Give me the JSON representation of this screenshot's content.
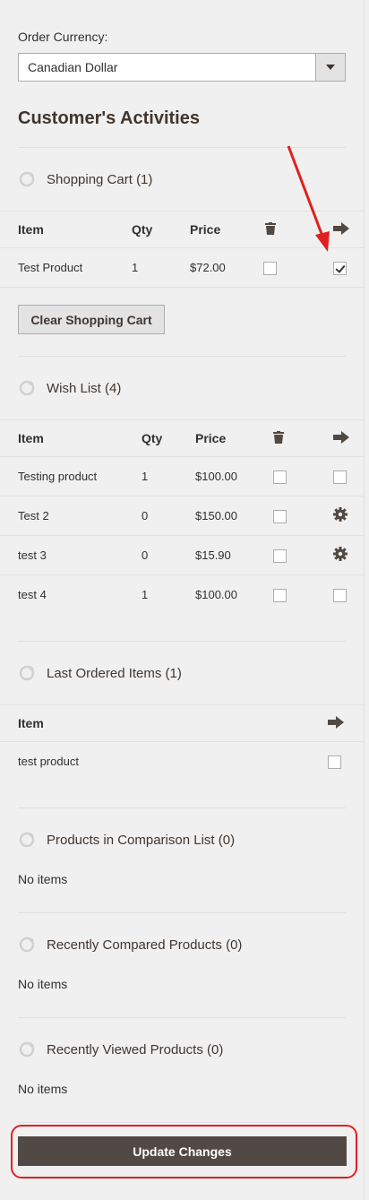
{
  "order_currency": {
    "label": "Order Currency:",
    "selected": "Canadian Dollar"
  },
  "activities_title": "Customer's Activities",
  "shopping_cart": {
    "title": "Shopping Cart (1)",
    "columns": [
      "Item",
      "Qty",
      "Price"
    ],
    "rows": [
      {
        "item": "Test Product",
        "qty": "1",
        "price": "$72.00",
        "remove": false,
        "move": true
      }
    ],
    "clear_button": "Clear Shopping Cart"
  },
  "wish_list": {
    "title": "Wish List (4)",
    "columns": [
      "Item",
      "Qty",
      "Price"
    ],
    "rows": [
      {
        "item": "Testing product",
        "qty": "1",
        "price": "$100.00",
        "action": "checkbox"
      },
      {
        "item": "Test 2",
        "qty": "0",
        "price": "$150.00",
        "action": "gear"
      },
      {
        "item": "test 3",
        "qty": "0",
        "price": "$15.90",
        "action": "gear"
      },
      {
        "item": "test 4",
        "qty": "1",
        "price": "$100.00",
        "action": "checkbox"
      }
    ]
  },
  "last_ordered": {
    "title": "Last Ordered Items (1)",
    "columns": [
      "Item"
    ],
    "rows": [
      {
        "item": "test product"
      }
    ]
  },
  "comparison_list": {
    "title": "Products in Comparison List (0)",
    "empty": "No items"
  },
  "recently_compared": {
    "title": "Recently Compared Products (0)",
    "empty": "No items"
  },
  "recently_viewed": {
    "title": "Recently Viewed Products (0)",
    "empty": "No items"
  },
  "update_button": "Update Changes",
  "icons": {
    "refresh": "refresh-icon",
    "trash": "trash-icon",
    "move": "arrow-right-icon",
    "configure": "gear-icon"
  },
  "colors": {
    "accent_button": "#514943",
    "annotation": "#e02020"
  }
}
